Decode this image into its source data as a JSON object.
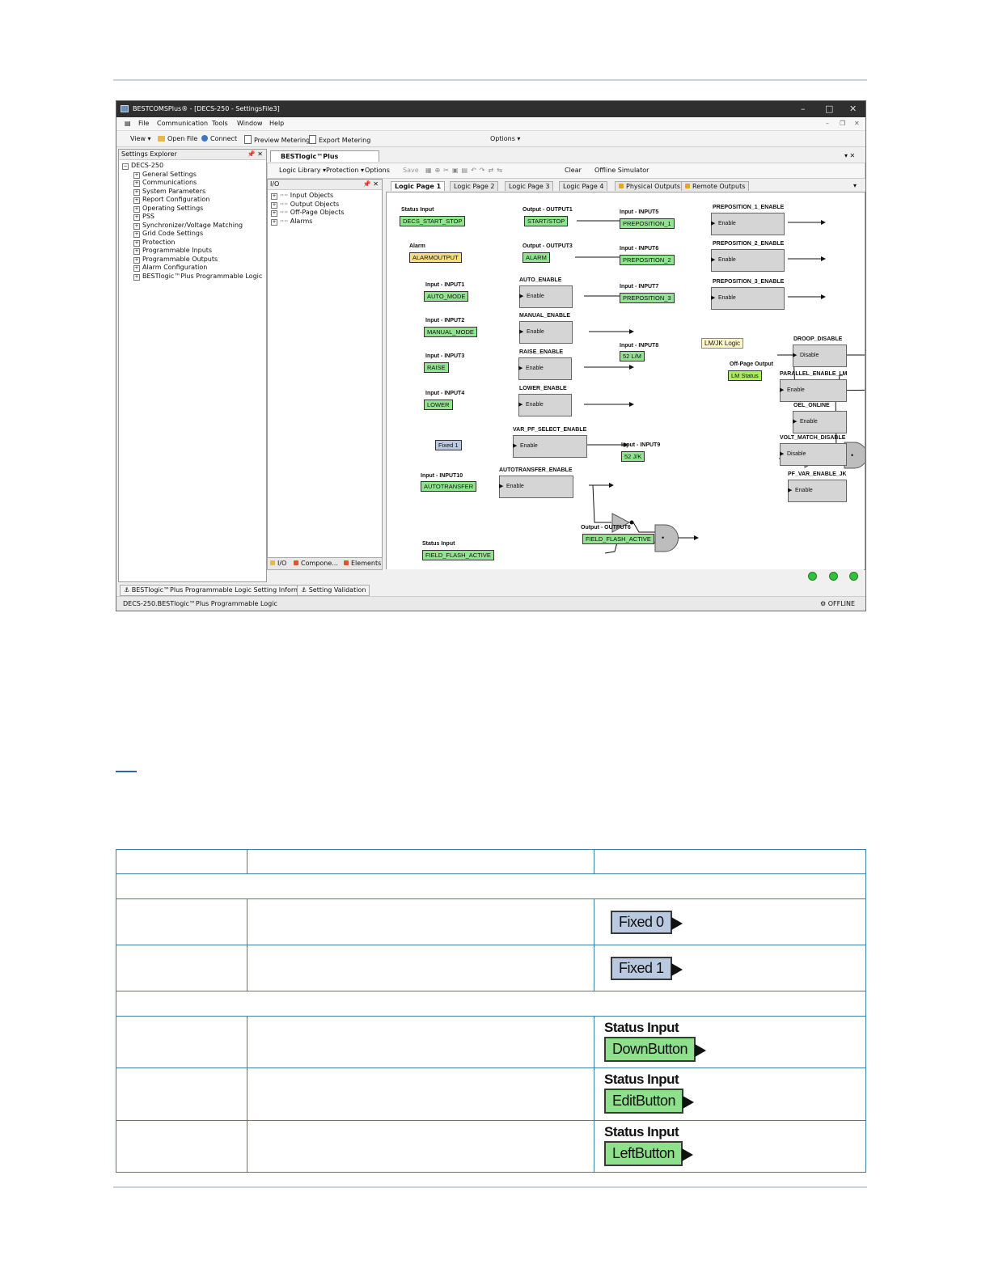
{
  "window": {
    "title": "BESTCOMSPlus® - [DECS-250 - SettingsFile3]",
    "controls": {
      "minimize": "–",
      "maximize": "□",
      "close": "✕",
      "inner_min": "–",
      "inner_restore": "❐",
      "inner_close": "✕"
    }
  },
  "menubar": {
    "items": [
      "File",
      "Communication",
      "Tools",
      "Window",
      "Help"
    ]
  },
  "toolbar": {
    "view": "View ▾",
    "open_file": "Open File",
    "connect": "Connect",
    "preview_metering": "Preview Metering",
    "export_metering": "Export Metering",
    "options": "Options ▾"
  },
  "explorer": {
    "title": "Settings Explorer",
    "root": "DECS-250",
    "items": [
      "General Settings",
      "Communications",
      "System Parameters",
      "Report Configuration",
      "Operating Settings",
      "PSS",
      "Synchronizer/Voltage Matching",
      "Grid Code Settings",
      "Protection",
      "Programmable Inputs",
      "Programmable Outputs",
      "Alarm Configuration",
      "BESTlogic™Plus Programmable Logic"
    ]
  },
  "document": {
    "tab": "BESTlogic™Plus Programmabl...",
    "logic_library": "Logic Library ▾",
    "protection": "Protection ▾",
    "options": "Options",
    "save": "Save",
    "clear": "Clear",
    "offline_simulator": "Offline Simulator"
  },
  "io_panel": {
    "title": "I/O",
    "items": [
      "Input Objects",
      "Output Objects",
      "Off-Page Objects",
      "Alarms"
    ],
    "tabs": [
      "I/O",
      "Compone...",
      "Elements"
    ]
  },
  "page_tabs": [
    "Logic Page 1",
    "Logic Page 2",
    "Logic Page 3",
    "Logic Page 4",
    "Physical Outputs",
    "Remote Outputs"
  ],
  "diagram": {
    "inputs": [
      {
        "label": "Status Input",
        "name": "DECS_START_STOP"
      },
      {
        "label": "Alarm",
        "name": "ALARMOUTPUT"
      },
      {
        "label": "Input - INPUT1",
        "name": "AUTO_MODE"
      },
      {
        "label": "Input - INPUT2",
        "name": "MANUAL_MODE"
      },
      {
        "label": "Input - INPUT3",
        "name": "RAISE"
      },
      {
        "label": "Input - INPUT4",
        "name": "LOWER"
      },
      {
        "label": "",
        "name": "Fixed 1"
      },
      {
        "label": "Input - INPUT10",
        "name": "AUTOTRANSFER"
      },
      {
        "label": "Status Input",
        "name": "FIELD_FLASH_ACTIVE"
      },
      {
        "label": "Input - INPUT5",
        "name": "PREPOSITION_1"
      },
      {
        "label": "Input - INPUT6",
        "name": "PREPOSITION_2"
      },
      {
        "label": "Input - INPUT7",
        "name": "PREPOSITION_3"
      },
      {
        "label": "Input - INPUT8",
        "name": "52 L/M"
      },
      {
        "label": "Input - INPUT9",
        "name": "52 J/K"
      }
    ],
    "outputs": [
      {
        "label": "Output - OUTPUT1",
        "name": "START/STOP"
      },
      {
        "label": "Output - OUTPUT3",
        "name": "ALARM"
      },
      {
        "label": "Output - OUTPUT6",
        "name": "FIELD_FLASH_ACTIVE"
      },
      {
        "label": "Off-Page Output",
        "name": "LM Status"
      }
    ],
    "functions": [
      {
        "title": "AUTO_ENABLE",
        "pin": "Enable"
      },
      {
        "title": "MANUAL_ENABLE",
        "pin": "Enable"
      },
      {
        "title": "RAISE_ENABLE",
        "pin": "Enable"
      },
      {
        "title": "LOWER_ENABLE",
        "pin": "Enable"
      },
      {
        "title": "VAR_PF_SELECT_ENABLE",
        "pin": "Enable"
      },
      {
        "title": "AUTOTRANSFER_ENABLE",
        "pin": "Enable"
      },
      {
        "title": "PREPOSITION_1_ENABLE",
        "pin": "Enable"
      },
      {
        "title": "PREPOSITION_2_ENABLE",
        "pin": "Enable"
      },
      {
        "title": "PREPOSITION_3_ENABLE",
        "pin": "Enable"
      },
      {
        "title": "DROOP_DISABLE",
        "pin": "Disable"
      },
      {
        "title": "PARALLEL_ENABLE_LM",
        "pin": "Enable"
      },
      {
        "title": "OEL_ONLINE",
        "pin": "Enable"
      },
      {
        "title": "VOLT_MATCH_DISABLE",
        "pin": "Disable"
      },
      {
        "title": "PF_VAR_ENABLE_JK",
        "pin": "Enable"
      }
    ],
    "note": "LM/JK Logic"
  },
  "bottom_tabs": [
    "BESTlogic™Plus Programmable Logic Setting Information",
    "Setting Validation"
  ],
  "statusbar": {
    "path": "DECS-250.BESTlogic™Plus Programmable Logic",
    "state": "OFFLINE"
  },
  "table": {
    "rows": [
      {
        "type": "fixed",
        "text": "Fixed 0"
      },
      {
        "type": "fixed",
        "text": "Fixed 1"
      },
      {
        "type": "status",
        "label": "Status Input",
        "text": "DownButton"
      },
      {
        "type": "status",
        "label": "Status Input",
        "text": "EditButton"
      },
      {
        "type": "status",
        "label": "Status Input",
        "text": "LeftButton"
      }
    ]
  }
}
